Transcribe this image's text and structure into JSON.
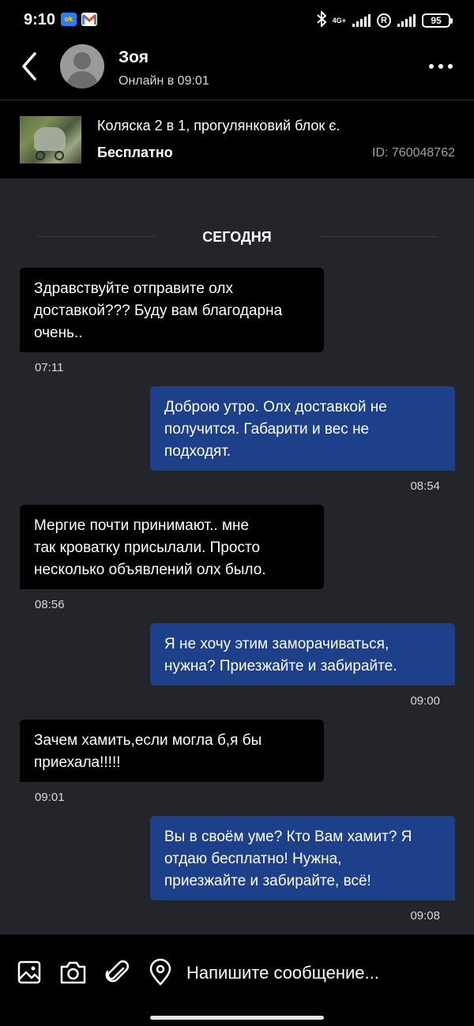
{
  "status_bar": {
    "time": "9:10",
    "app_badge": "ok",
    "network": "4G+",
    "battery": "95"
  },
  "header": {
    "contact_name": "Зоя",
    "contact_status": "Онлайн в 09:01"
  },
  "listing": {
    "title": "Коляска 2 в 1, прогулянковий блок є.",
    "price": "Бесплатно",
    "id": "ID: 760048762"
  },
  "date_divider": "СЕГОДНЯ",
  "messages": [
    {
      "direction": "in",
      "text": "Здравствуйте отправите олх\nдоставкой??? Буду вам благодарна\nочень..",
      "time": "07:11"
    },
    {
      "direction": "out",
      "text": "Доброю утро. Олх доставкой не\nполучится. Габарити и вес не\nподходят.",
      "time": "08:54"
    },
    {
      "direction": "in",
      "text": "Мергие почти принимают.. мне\nтак кроватку присылали. Просто\nнесколько объявлений олх было.",
      "time": "08:56"
    },
    {
      "direction": "out",
      "text": "Я не хочу этим заморачиваться,\nнужна? Приезжайте и забирайте.",
      "time": "09:00"
    },
    {
      "direction": "in",
      "text": "Зачем хамить,если могла б,я бы\nприехала!!!!!",
      "time": "09:01"
    },
    {
      "direction": "out",
      "text": "Вы в своём уме? Кто Вам хамит? Я\nотдаю бесплатно! Нужна,\nприезжайте и забирайте, всё!",
      "time": "09:08"
    }
  ],
  "composer": {
    "placeholder": "Напишите сообщение..."
  },
  "colors": {
    "background": "#24252a",
    "incoming_bubble": "#000000",
    "outgoing_bubble": "#1e3f8a"
  }
}
